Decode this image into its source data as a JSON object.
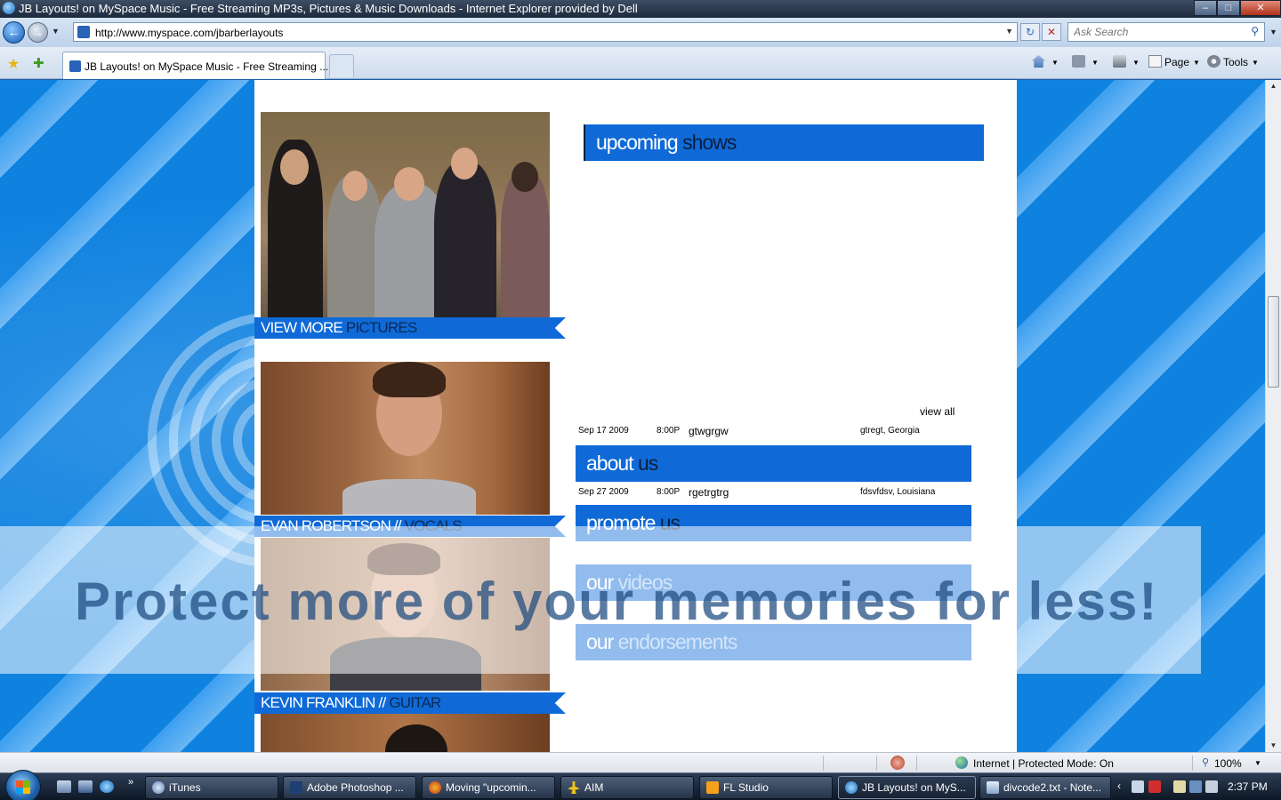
{
  "window": {
    "title": "JB Layouts! on MySpace Music - Free Streaming MP3s, Pictures & Music Downloads - Internet Explorer provided by Dell",
    "minimize_glyph": "–",
    "maximize_glyph": "□",
    "close_glyph": "✕"
  },
  "navbar": {
    "back_glyph": "←",
    "forward_glyph": "→",
    "url": "http://www.myspace.com/jbarberlayouts",
    "search_placeholder": "Ask Search",
    "refresh_glyph": "↻",
    "stop_glyph": "✕"
  },
  "tabs": [
    {
      "label": "JB Layouts! on MySpace Music - Free Streaming ...",
      "active": true
    }
  ],
  "commands": {
    "page_label": "Page",
    "tools_label": "Tools"
  },
  "page": {
    "captions": {
      "pictures": {
        "light": "VIEW MORE ",
        "dark": "PICTURES"
      },
      "member1": {
        "light": "EVAN ROBERTSON // ",
        "dark": "VOCALS"
      },
      "member2": {
        "light": "KEVIN FRANKLIN // ",
        "dark": "GUITAR"
      }
    },
    "sections": {
      "shows": {
        "light": "upcoming ",
        "dark": "shows"
      },
      "about": {
        "light": "about ",
        "dark": "us"
      },
      "promote": {
        "light": "promote ",
        "dark": "us"
      },
      "videos": {
        "light": "our ",
        "dark": "videos"
      },
      "endorsements": {
        "light": "our ",
        "dark": "endorsements"
      }
    },
    "view_all": "view all",
    "shows": [
      {
        "date": "Sep 17 2009",
        "time": "8:00P",
        "venue": "gtwgrgw",
        "location": "gtregt, Georgia"
      },
      {
        "date": "Sep 27 2009",
        "time": "8:00P",
        "venue": "rgetrgtrg",
        "location": "fdsvfdsv, Louisiana"
      }
    ],
    "overlay_ad": "Protect more of your memories for less!"
  },
  "statusbar": {
    "zone": "Internet | Protected Mode: On",
    "zoom": "100%"
  },
  "taskbar": {
    "items": [
      {
        "label": "iTunes",
        "icon": "itunes-icon"
      },
      {
        "label": "Adobe Photoshop ...",
        "icon": "photoshop-icon"
      },
      {
        "label": "Moving \"upcomin...",
        "icon": "firefox-icon"
      },
      {
        "label": "AIM",
        "icon": "aim-icon"
      },
      {
        "label": "FL Studio",
        "icon": "fl-studio-icon"
      },
      {
        "label": "JB Layouts! on MyS...",
        "icon": "ie-icon",
        "active": true
      },
      {
        "label": "divcode2.txt - Note...",
        "icon": "notepad-icon"
      }
    ],
    "clock": "2:37 PM"
  },
  "colors": {
    "accent_blue": "#0f6ad8",
    "dark_navy": "#0b1f3d",
    "background_blue": "#0f82e0"
  }
}
